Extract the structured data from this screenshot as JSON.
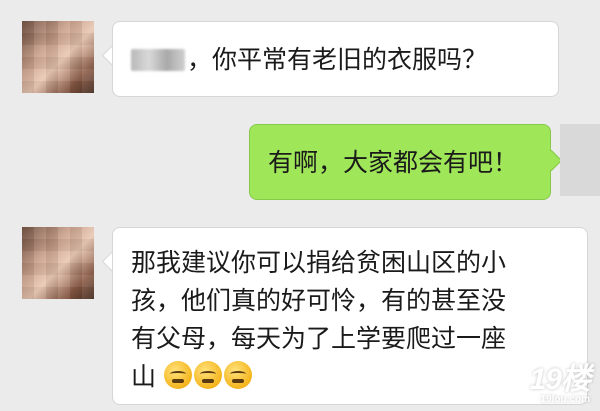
{
  "messages": [
    {
      "side": "left",
      "text": "，你平常有老旧的衣服吗？"
    },
    {
      "side": "right",
      "text": "有啊，大家都会有吧！"
    },
    {
      "side": "left",
      "lines": [
        "那我建议你可以捐给贫困山区的小",
        "孩，他们真的好可怜，有的甚至没",
        "有父母，每天为了上学要爬过一座",
        "山"
      ],
      "emojis": [
        "angry-face-emoji",
        "angry-face-emoji",
        "angry-face-emoji"
      ]
    }
  ],
  "watermark": {
    "main": "19楼",
    "sub": "19lou.com"
  },
  "colors": {
    "background": "#ebebeb",
    "left_bubble": "#ffffff",
    "right_bubble": "#9fe658"
  }
}
